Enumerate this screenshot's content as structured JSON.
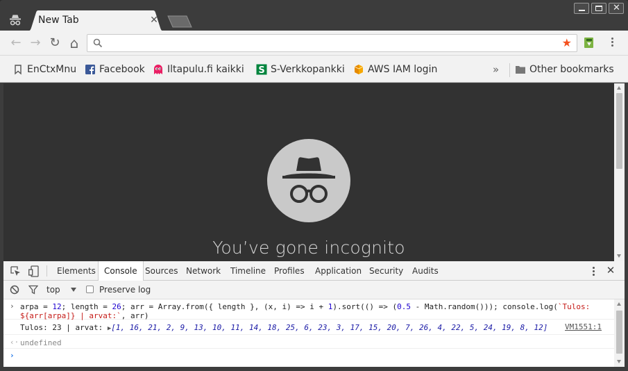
{
  "tab": {
    "title": "New Tab",
    "close_label": "✕"
  },
  "window_controls": {
    "minimize": "minimize",
    "maximize": "maximize",
    "close": "close"
  },
  "toolbar": {
    "back_label": "←",
    "forward_label": "→",
    "reload_label": "↻",
    "home_label": "⌂",
    "omnibox_value": "",
    "star_label": "★"
  },
  "bookmarks": {
    "items": [
      {
        "label": "EnCtxMnu",
        "icon": "bookmark-outline-icon"
      },
      {
        "label": "Facebook",
        "icon": "facebook-icon"
      },
      {
        "label": "Iltapulu.fi kaikki",
        "icon": "iltapulu-icon"
      },
      {
        "label": "S-Verkkopankki",
        "icon": "s-bank-icon"
      },
      {
        "label": "AWS IAM login",
        "icon": "aws-icon"
      }
    ],
    "overflow_label": "»",
    "other_label": "Other bookmarks"
  },
  "page": {
    "title": "You’ve gone incognito"
  },
  "devtools": {
    "tabs": [
      "Elements",
      "Console",
      "Sources",
      "Network",
      "Timeline",
      "Profiles",
      "Application",
      "Security",
      "Audits"
    ],
    "active_tab": "Console",
    "context": "top",
    "preserve_log": "Preserve log",
    "console": {
      "input_line1_a": "arpa = ",
      "input_line1_n1": "12",
      "input_line1_b": "; length = ",
      "input_line1_n2": "26",
      "input_line1_c": "; arr = Array.from({ length }, (x, i) => i + ",
      "input_line1_n3": "1",
      "input_line1_d": ").sort(() => (",
      "input_line1_n4": "0.5",
      "input_line1_e": " - Math.random())); console.log(",
      "input_line1_str": "`Tulos:",
      "input_line2_str_a": "${arr[arpa]}",
      "input_line2_str_b": " | arvat:`",
      "input_line2_rest": ", arr)",
      "output_prefix": "Tulos: 23 | arvat: ",
      "output_array": "[1, 16, 21, 2, 9, 13, 10, 11, 14, 18, 25, 6, 23, 3, 17, 15, 20, 7, 26, 4, 22, 5, 24, 19, 8, 12]",
      "output_source": "VM1551:1",
      "return_value": "undefined"
    }
  }
}
